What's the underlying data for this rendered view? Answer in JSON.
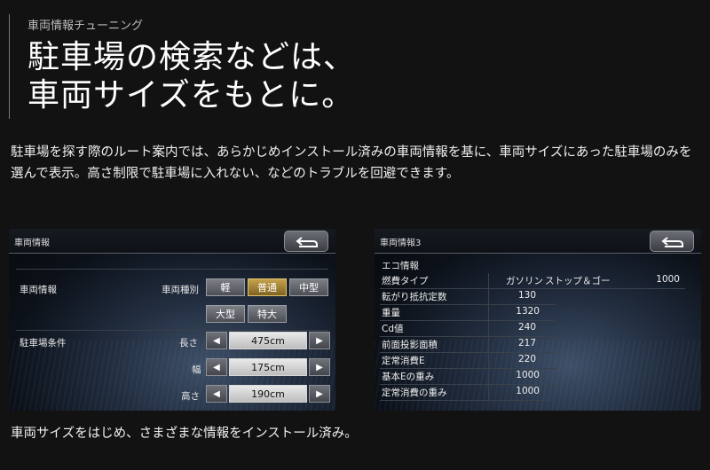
{
  "hero": {
    "kicker": "車両情報チューニング",
    "headline_line1": "駐車場の検索などは、",
    "headline_line2": "車両サイズをもとに。"
  },
  "lead_text": "駐車場を探す際のルート案内では、あらかじめインストール済みの車両情報を基に、車両サイズにあった駐車場のみを選んで表示。高さ制限で駐車場に入れない、などのトラブルを回避できます。",
  "caption": "車両サイズをはじめ、さまざまな情報をインストール済み。",
  "screen1": {
    "title": "車両情報",
    "back_icon": "return-arrow-icon",
    "section_vehicle": "車両情報",
    "vehicle_type_label": "車両種別",
    "types": [
      "軽",
      "普通",
      "中型",
      "大型",
      "特大"
    ],
    "selected_type": "普通",
    "section_parking": "駐車場条件",
    "dims": [
      {
        "label": "長さ",
        "value": "475cm"
      },
      {
        "label": "幅",
        "value": "175cm"
      },
      {
        "label": "高さ",
        "value": "190cm"
      }
    ],
    "arrow_left": "◀",
    "arrow_right": "▶",
    "selected_color": "#c6a24a"
  },
  "screen2": {
    "title": "車両情報3",
    "section": "エコ情報",
    "rows": [
      {
        "k": "燃費タイプ",
        "v": "ガソリン"
      },
      {
        "k": "転がり抵抗定数",
        "v": "130"
      },
      {
        "k": "重量",
        "v": "1320"
      },
      {
        "k": "Cd値",
        "v": "240"
      },
      {
        "k": "前面投影面積",
        "v": "217"
      },
      {
        "k": "定常消費E",
        "v": "220"
      },
      {
        "k": "基本Eの重み",
        "v": "1000"
      },
      {
        "k": "定常消費の重み",
        "v": "1000"
      }
    ],
    "side": {
      "k": "ストップ＆ゴー",
      "v": "1000"
    }
  }
}
